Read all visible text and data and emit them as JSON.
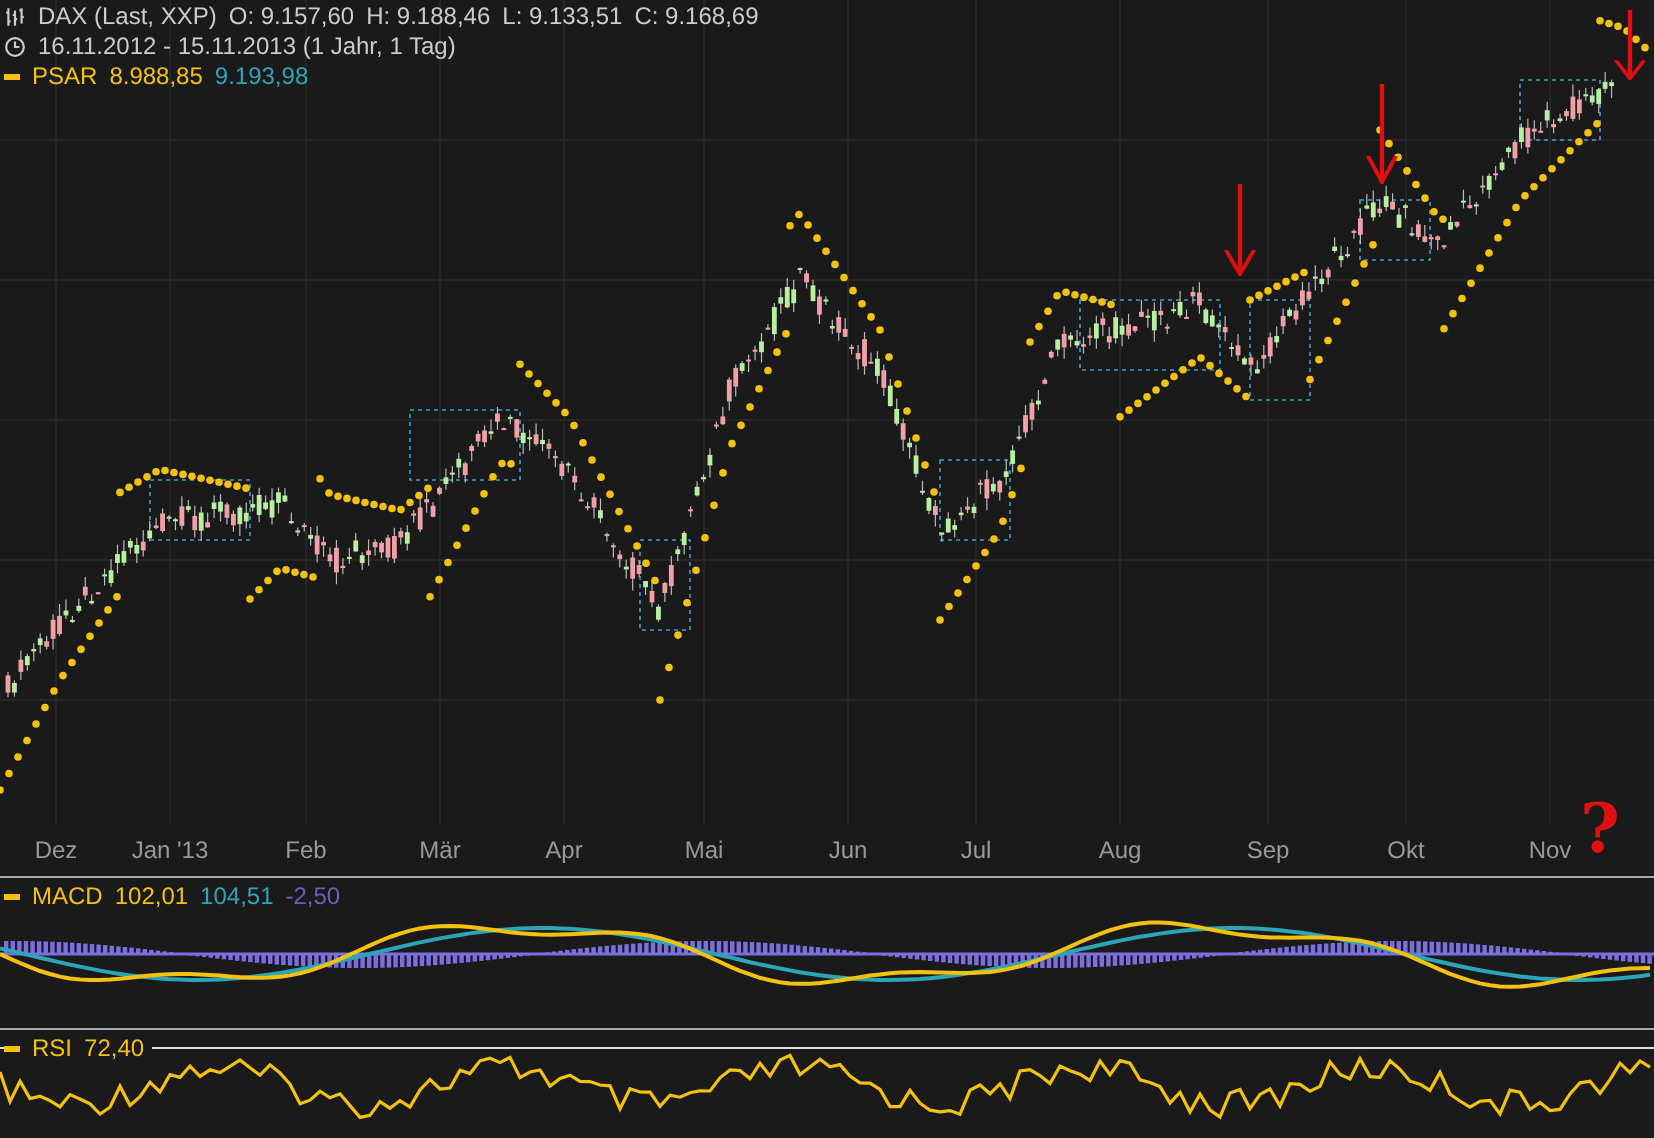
{
  "header": {
    "symbol": "DAX (Last, XXP)",
    "ohlc": [
      "O: 9.157,60",
      "H: 9.188,46",
      "L: 9.133,51",
      "C: 9.168,69"
    ],
    "period": "16.11.2012 - 15.11.2013 (1 Jahr, 1 Tag)",
    "psar": {
      "label": "PSAR",
      "value_1": "8.988,85",
      "value_2": "9.193,98"
    }
  },
  "x_axis": [
    "Dez",
    "Jan '13",
    "Feb",
    "Mär",
    "Apr",
    "Mai",
    "Jun",
    "Jul",
    "Aug",
    "Sep",
    "Okt",
    "Nov"
  ],
  "annotation_mark": "?",
  "macd": {
    "label": "MACD",
    "value_1": "102,01",
    "value_2": "104,51",
    "value_3": "-2,50"
  },
  "rsi": {
    "label": "RSI",
    "value": "72,40"
  }
}
